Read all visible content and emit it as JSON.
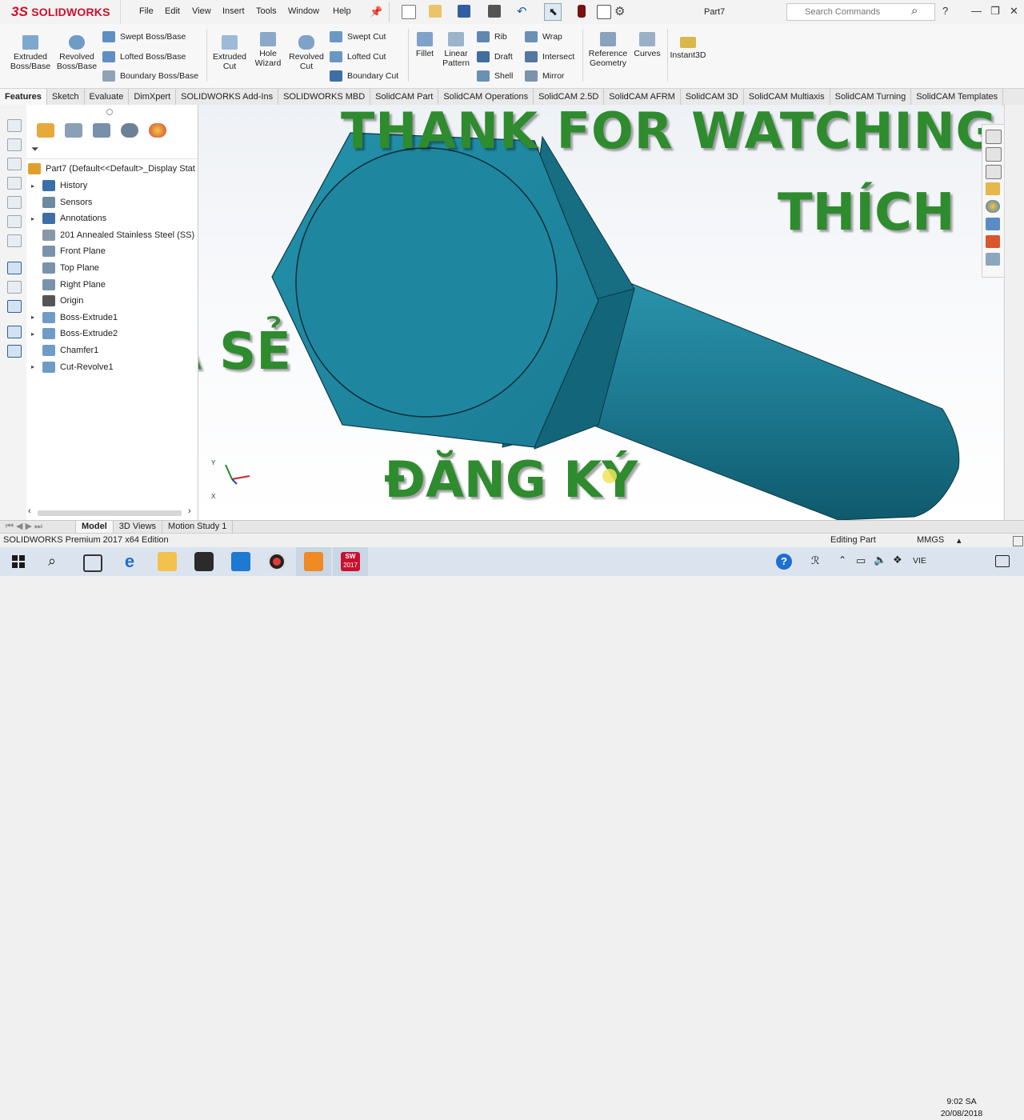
{
  "app": {
    "logo_text": "SOLIDWORKS",
    "menu": [
      "File",
      "Edit",
      "View",
      "Insert",
      "Tools",
      "Window",
      "Help"
    ],
    "doc_title": "Part7",
    "search_placeholder": "Search Commands"
  },
  "ribbon": {
    "extruded_boss": "Extruded Boss/Base",
    "revolved_boss": "Revolved Boss/Base",
    "swept_boss": "Swept Boss/Base",
    "lofted_boss": "Lofted Boss/Base",
    "boundary_boss": "Boundary Boss/Base",
    "extruded_cut": "Extruded Cut",
    "hole_wizard": "Hole Wizard",
    "revolved_cut": "Revolved Cut",
    "swept_cut": "Swept Cut",
    "lofted_cut": "Lofted Cut",
    "boundary_cut": "Boundary Cut",
    "fillet": "Fillet",
    "linear_pattern": "Linear Pattern",
    "rib": "Rib",
    "draft": "Draft",
    "shell": "Shell",
    "wrap": "Wrap",
    "intersect": "Intersect",
    "mirror": "Mirror",
    "reference_geometry": "Reference Geometry",
    "curves": "Curves",
    "instant3d": "Instant3D"
  },
  "tabs": [
    "Features",
    "Sketch",
    "Evaluate",
    "DimXpert",
    "SOLIDWORKS Add-Ins",
    "SOLIDWORKS MBD",
    "SolidCAM Part",
    "SolidCAM Operations",
    "SolidCAM 2.5D",
    "SolidCAM AFRM",
    "SolidCAM 3D",
    "SolidCAM Multiaxis",
    "SolidCAM Turning",
    "SolidCAM Templates"
  ],
  "tree": {
    "root": "Part7  (Default<<Default>_Display Stat",
    "items": [
      {
        "label": "History",
        "expand": true
      },
      {
        "label": "Sensors",
        "expand": false
      },
      {
        "label": "Annotations",
        "expand": true
      },
      {
        "label": "201 Annealed Stainless Steel (SS)",
        "expand": false
      },
      {
        "label": "Front Plane",
        "expand": false
      },
      {
        "label": "Top Plane",
        "expand": false
      },
      {
        "label": "Right Plane",
        "expand": false
      },
      {
        "label": "Origin",
        "expand": false
      },
      {
        "label": "Boss-Extrude1",
        "expand": true
      },
      {
        "label": "Boss-Extrude2",
        "expand": true
      },
      {
        "label": "Chamfer1",
        "expand": false
      },
      {
        "label": "Cut-Revolve1",
        "expand": true
      }
    ]
  },
  "overlay": {
    "line1": "THANK FOR WATCHING",
    "like": "THÍCH",
    "share": "CHIA SẺ",
    "subscribe": "ĐĂNG KÝ"
  },
  "bottom_tabs": [
    "Model",
    "3D Views",
    "Motion Study 1"
  ],
  "status": {
    "edition": "SOLIDWORKS Premium 2017 x64 Edition",
    "mode": "Editing Part",
    "units": "MMGS"
  },
  "taskbar": {
    "lang": "VIE",
    "time": "9:02 SA",
    "date": "20/08/2018",
    "sw_badge": "2017"
  },
  "colors": {
    "part": "#1d7d93",
    "overlay_text": "#2e8b2e",
    "logo": "#c8102e"
  }
}
